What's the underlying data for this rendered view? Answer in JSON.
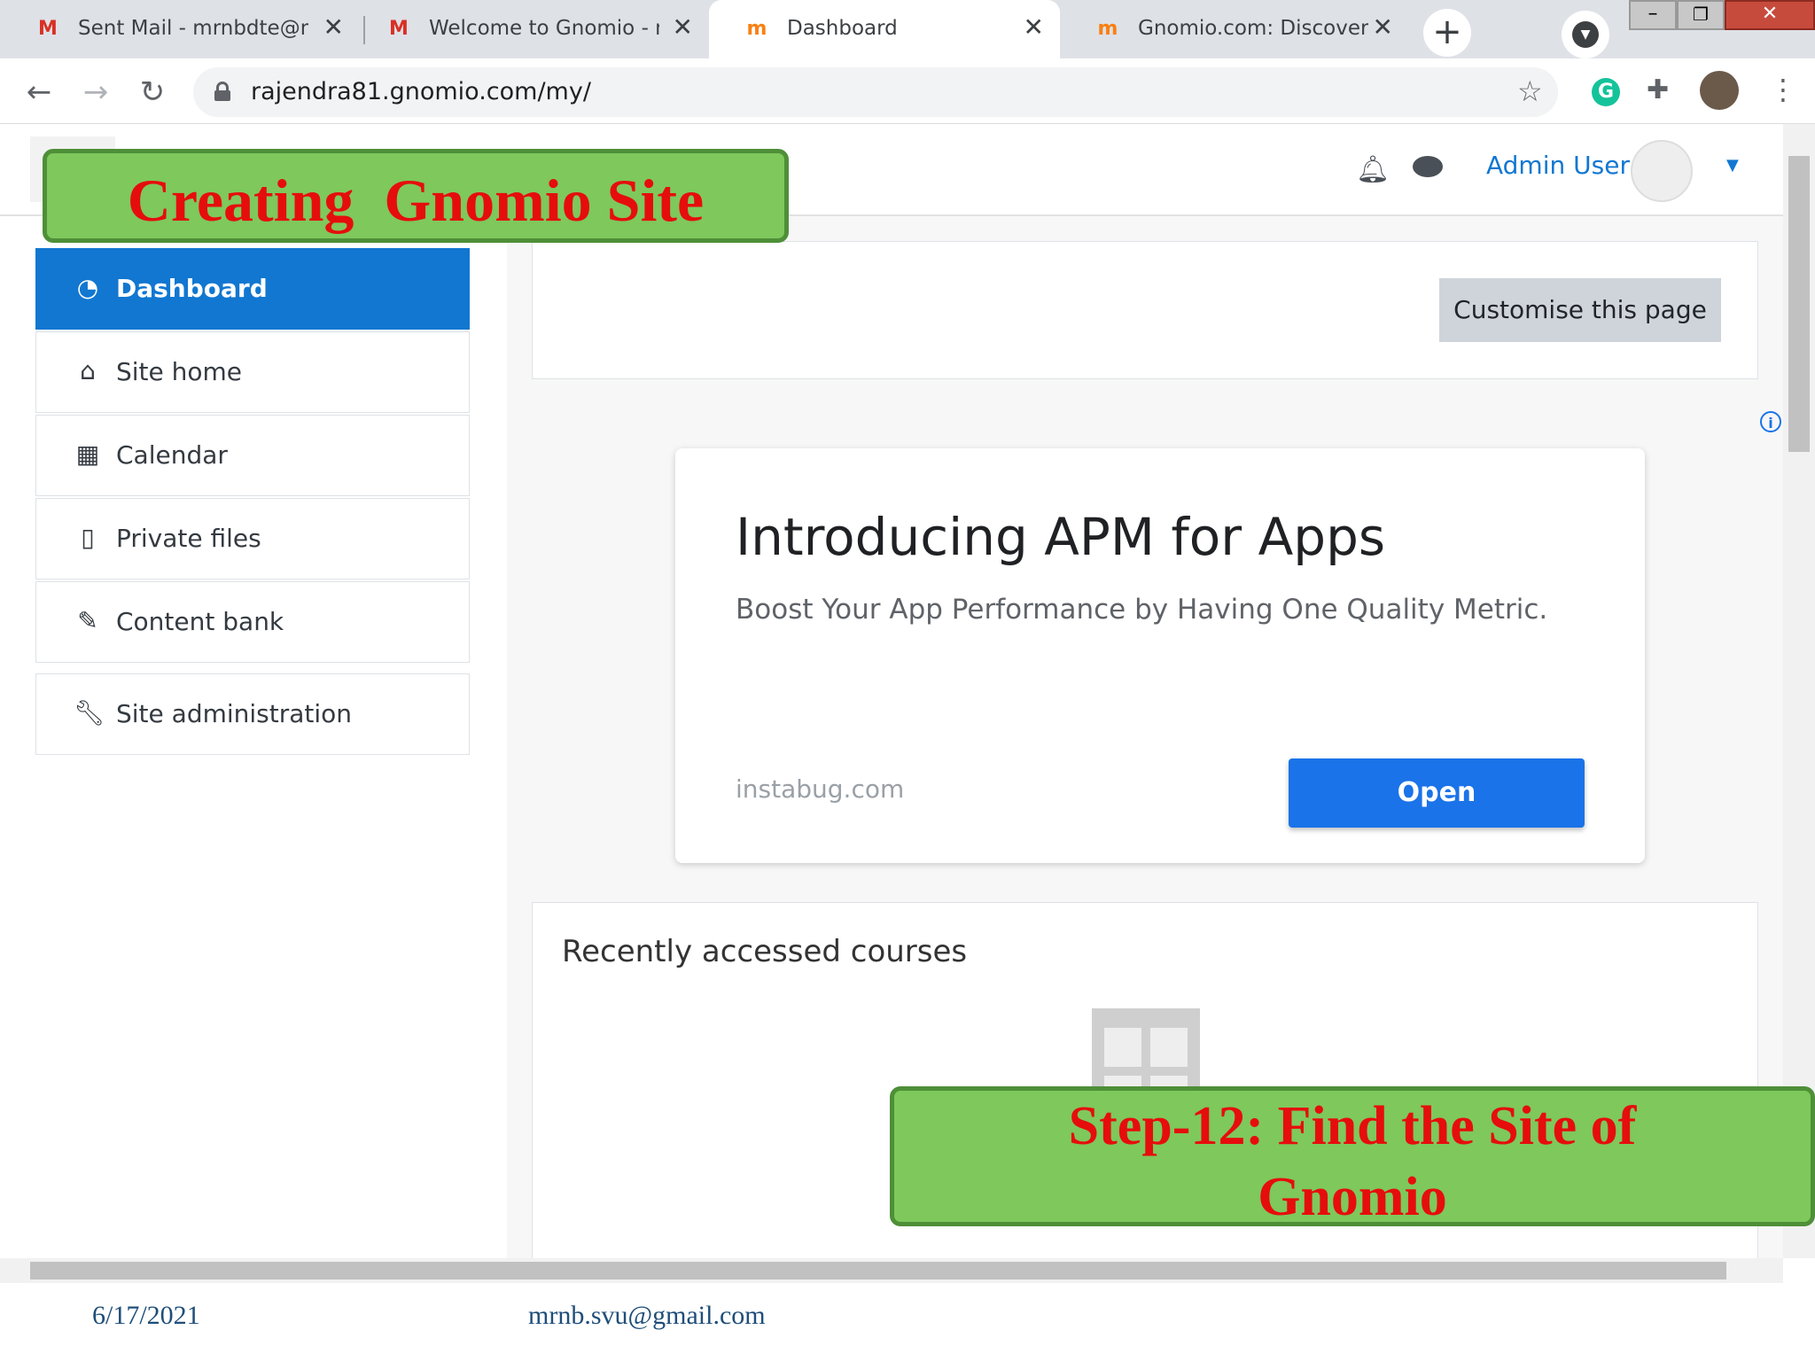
{
  "browser": {
    "tabs": [
      {
        "title": "Sent Mail - mrnbdte@na",
        "favicon": "gmail-icon"
      },
      {
        "title": "Welcome to Gnomio - m",
        "favicon": "gmail-icon"
      },
      {
        "title": "Dashboard",
        "favicon": "moodle-icon",
        "active": true
      },
      {
        "title": "Gnomio.com: Discover M",
        "favicon": "moodle-icon"
      }
    ],
    "url": "rajendra81.gnomio.com/my/"
  },
  "header": {
    "user_name": "Admin User"
  },
  "nav": {
    "items": [
      {
        "label": "Dashboard",
        "icon": "dashboard-icon",
        "active": true
      },
      {
        "label": "Site home",
        "icon": "home-icon"
      },
      {
        "label": "Calendar",
        "icon": "calendar-icon"
      },
      {
        "label": "Private files",
        "icon": "file-icon"
      },
      {
        "label": "Content bank",
        "icon": "brush-icon"
      },
      {
        "label": "Site administration",
        "icon": "wrench-icon"
      }
    ]
  },
  "main": {
    "customise_label": "Customise this page",
    "ad": {
      "title": "Introducing APM for Apps",
      "subtitle": "Boost Your App Performance by Having One Quality Metric.",
      "domain": "instabug.com",
      "button": "Open"
    },
    "courses_title": "Recently accessed courses"
  },
  "callouts": {
    "top": "Creating  Gnomio Site",
    "bottom_line1": "Step-12: Find the Site of",
    "bottom_line2": "Gnomio"
  },
  "footer": {
    "date": "6/17/2021",
    "email": "mrnb.svu@gmail.com"
  },
  "colors": {
    "moodle_blue": "#1177d1",
    "ad_button": "#1a73e8",
    "callout_green": "#7ec85c",
    "callout_text": "#e60d0d"
  }
}
